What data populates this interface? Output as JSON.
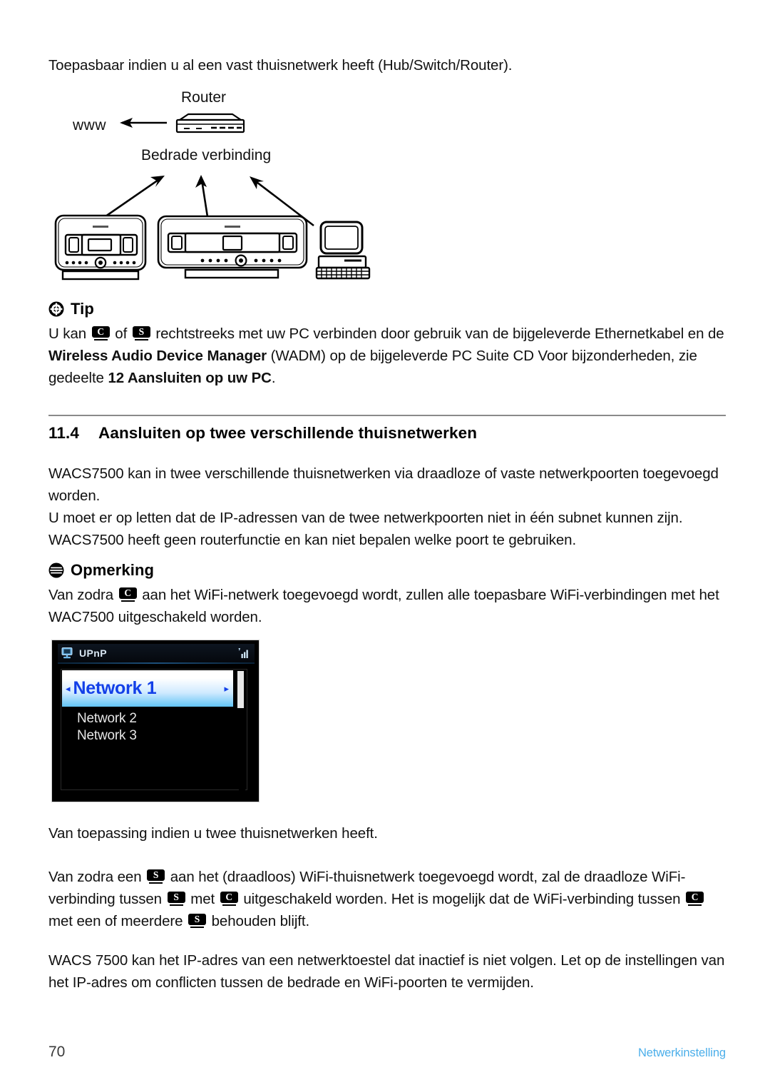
{
  "document": {
    "intro": "Toepasbaar indien u al een vast thuisnetwerk heeft (Hub/Switch/Router)."
  },
  "diagram": {
    "router_label": "Router",
    "www_label": "www",
    "wired_label": "Bedrade verbinding",
    "devices": [
      "center-device",
      "station-device",
      "pc-device"
    ]
  },
  "tip": {
    "heading": "Tip",
    "icon": "asterisk-circle-icon",
    "line1_a": "U kan",
    "badge_c": "C",
    "line1_b": "of",
    "badge_s": "S",
    "line1_c": "rechtstreeks met uw PC verbinden door gebruik van de bijgeleverde",
    "line2_a": "Ethernetkabel en de",
    "line2_bold": "Wireless Audio Device Manager",
    "line2_b": "(WADM) op de bijgeleverde PC Suite",
    "line3_a": "CD Voor bijzonderheden, zie gedeelte",
    "line3_bold": "12 Aansluiten op uw PC",
    "line3_b": "."
  },
  "section": {
    "number": "11.4",
    "title": "Aansluiten op twee verschillende thuisnetwerken",
    "para1": "WACS7500 kan in twee verschillende thuisnetwerken via draadloze of vaste netwerkpoorten toegevoegd worden.",
    "para2": "U moet er op letten dat de IP-adressen van de twee netwerkpoorten niet in één subnet kunnen zijn. WACS7500 heeft geen routerfunctie en kan niet bepalen welke poort te gebruiken."
  },
  "note": {
    "heading": "Opmerking",
    "icon": "note-lines-circle-icon",
    "line_a": "Van zodra",
    "badge_c": "C",
    "line_b": "aan het WiFi-netwerk toegevoegd wordt, zullen alle toepasbare WiFi-verbindingen met het WAC7500 uitgeschakeld worden."
  },
  "lcd": {
    "status_icon": "pc-monitor-icon",
    "status_label": "UPnP",
    "signal_icon": "signal-bars-icon",
    "items": [
      {
        "label": "Network 1",
        "selected": true
      },
      {
        "label": "Network 2",
        "selected": false
      },
      {
        "label": "Network 3",
        "selected": false
      }
    ],
    "left_arrow": "◂",
    "right_arrow": "▸"
  },
  "body": {
    "para3": "Van toepassing indien u twee thuisnetwerken heeft.",
    "para4_a": "Van zodra een",
    "para4_badge_s1": "S",
    "para4_b": "aan het (draadloos) WiFi-thuisnetwerk toegevoegd wordt, zal de draadloze WiFi-verbinding tussen",
    "para4_badge_s2": "S",
    "para4_c": "met",
    "para4_badge_c1": "C",
    "para4_d": "uitgeschakeld worden. Het is mogelijk dat de WiFi-verbinding tussen",
    "para4_badge_c2": "C",
    "para4_e": "met een of meerdere",
    "para4_badge_s3": "S",
    "para4_f": "behouden blijft.",
    "para5": "WACS 7500 kan het IP-adres van een netwerktoestel dat inactief is niet volgen. Let op de instellingen van het IP-adres om conflicten tussen de bedrade en WiFi-poorten te vermijden."
  },
  "footer": {
    "page_number": "70",
    "section_name": "Netwerkinstelling",
    "section_color": "#4aaeea"
  }
}
